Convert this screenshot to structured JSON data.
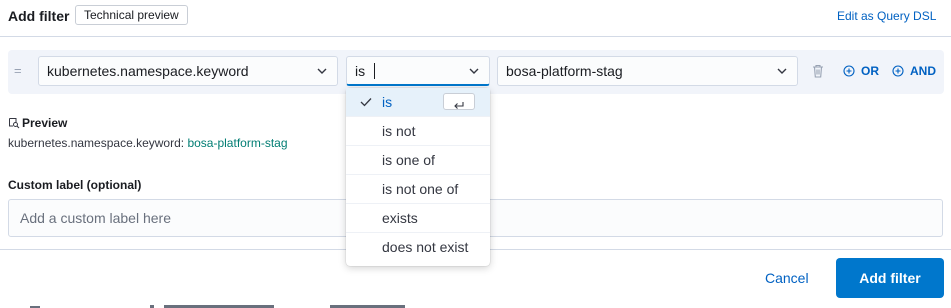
{
  "header": {
    "title": "Add filter",
    "badge": "Technical preview",
    "edit_dsl": "Edit as Query DSL"
  },
  "filter_row": {
    "drag_handle": "=",
    "field": "kubernetes.namespace.keyword",
    "operator": "is",
    "value": "bosa-platform-stag",
    "or_label": "OR",
    "and_label": "AND"
  },
  "operator_menu": {
    "options": [
      "is",
      "is not",
      "is one of",
      "is not one of",
      "exists",
      "does not exist"
    ],
    "selected_index": 0
  },
  "preview": {
    "title": "Preview",
    "field": "kubernetes.namespace.keyword:",
    "value": "bosa-platform-stag"
  },
  "custom_label": {
    "title": "Custom label (optional)",
    "placeholder": "Add a custom label here"
  },
  "footer": {
    "cancel": "Cancel",
    "submit": "Add filter"
  },
  "colors": {
    "accent": "#0077cc",
    "link": "#0061c2",
    "preview_value": "#017d73"
  },
  "icons": [
    "drag-handle-icon",
    "chevron-down-icon",
    "trash-icon",
    "plus-circle-icon",
    "check-icon",
    "enter-key-icon",
    "preview-icon"
  ]
}
